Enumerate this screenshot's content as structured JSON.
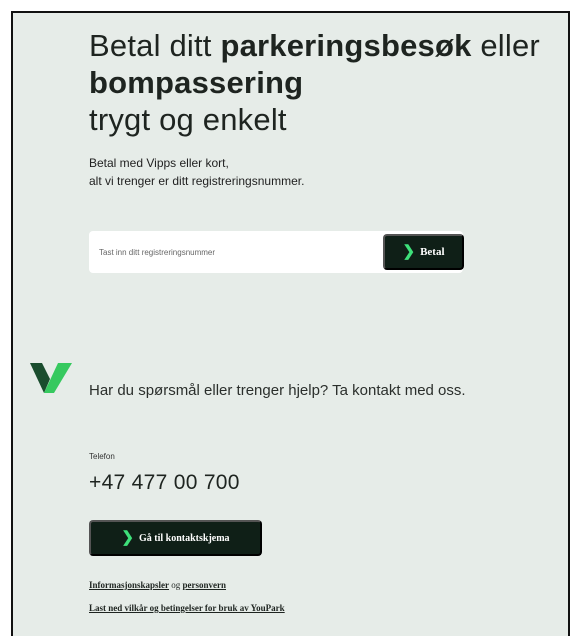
{
  "hero": {
    "title_part1": "Betal ditt ",
    "title_bold1": "parkeringsbesøk",
    "title_part2": " eller ",
    "title_bold2": "bompassering",
    "title_part3": "trygt og enkelt",
    "subtitle_line1": "Betal med Vipps eller kort,",
    "subtitle_line2": "alt vi trenger er ditt registreringsnummer."
  },
  "search": {
    "placeholder": "Tast inn ditt registreringsnummer",
    "value": "",
    "button_label": "Betal",
    "button_icon": "chevron-right-icon"
  },
  "brand": {
    "logo": "youpark-logo",
    "logo_color": "#36c95f"
  },
  "help": {
    "text": "Har du spørsmål eller trenger hjelp? Ta kontakt med oss.",
    "phone_label": "Telefon",
    "phone_number": "+47 477 00 700",
    "contact_button_label": "Gå til kontaktskjema"
  },
  "footer": {
    "cookies_link": "Informasjonskapsler",
    "conjunction": "og",
    "privacy_link": "personvern",
    "terms_link": "Last ned vilkår og betingelser for bruk av YouPark"
  },
  "colors": {
    "background": "#e6ece8",
    "button_bg": "#0f1f17",
    "accent_green": "#3ee07a"
  }
}
